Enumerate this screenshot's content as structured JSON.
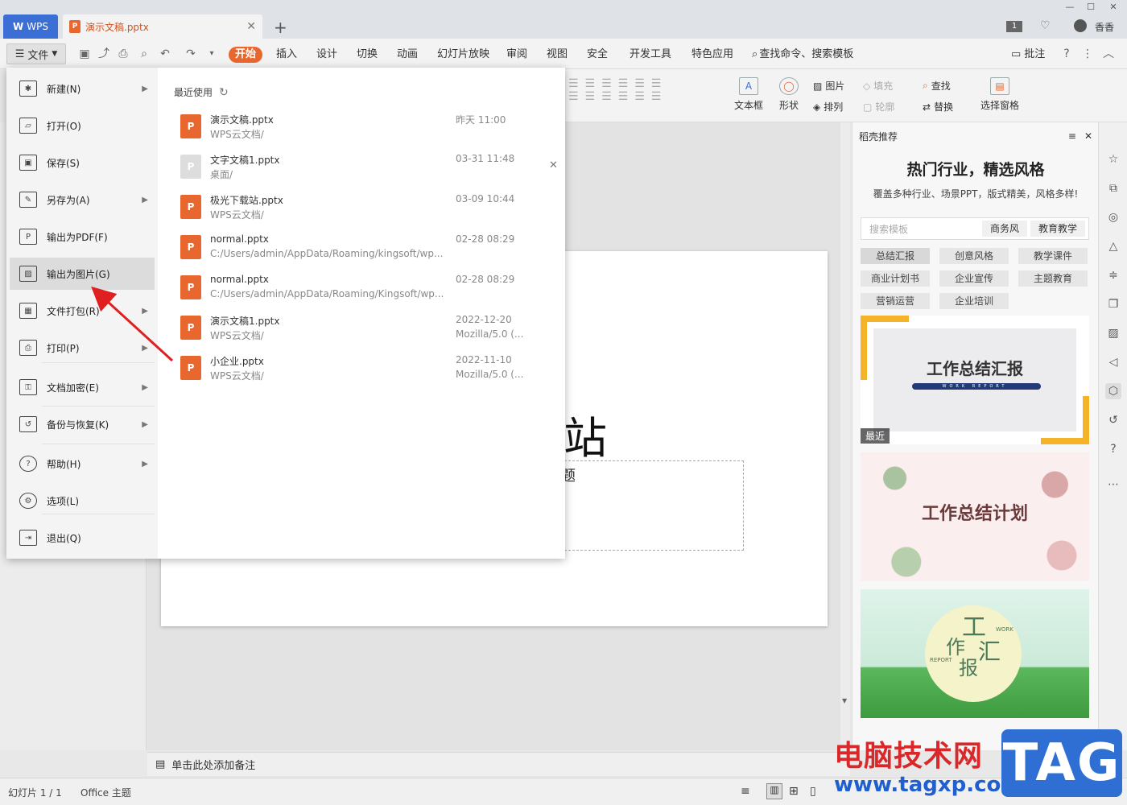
{
  "titlebar": {
    "wps_tab": "WPS",
    "doc_tab": "演示文稿.pptx",
    "page_badge": "1",
    "user": "香香"
  },
  "menubar": {
    "file": "文件",
    "tabs": [
      "开始",
      "插入",
      "设计",
      "切换",
      "动画",
      "幻灯片放映",
      "审阅",
      "视图",
      "安全",
      "开发工具",
      "特色应用"
    ],
    "search": "查找命令、搜索模板",
    "comment": "批注"
  },
  "ribbon": {
    "textbox": "文本框",
    "shape": "形状",
    "picture": "图片",
    "fill": "填充",
    "find": "查找",
    "arrange": "排列",
    "outline": "轮廓",
    "replace": "替换",
    "pane": "选择窗格"
  },
  "file_menu": {
    "items": [
      {
        "label": "新建(N)",
        "icon": "new-icon"
      },
      {
        "label": "打开(O)",
        "icon": "open-icon"
      },
      {
        "label": "保存(S)",
        "icon": "save-icon"
      },
      {
        "label": "另存为(A)",
        "icon": "save-as-icon"
      },
      {
        "label": "输出为PDF(F)",
        "icon": "pdf-icon"
      },
      {
        "label": "输出为图片(G)",
        "icon": "image-icon"
      },
      {
        "label": "文件打包(R)",
        "icon": "package-icon"
      },
      {
        "label": "打印(P)",
        "icon": "print-icon"
      },
      {
        "label": "文档加密(E)",
        "icon": "encrypt-icon"
      },
      {
        "label": "备份与恢复(K)",
        "icon": "backup-icon"
      },
      {
        "label": "帮助(H)",
        "icon": "help-icon"
      },
      {
        "label": "选项(L)",
        "icon": "options-icon"
      },
      {
        "label": "退出(Q)",
        "icon": "exit-icon"
      }
    ],
    "recent_title": "最近使用",
    "recent_files": [
      {
        "name": "演示文稿.pptx",
        "path": "WPS云文档/",
        "date": "昨天 11:00",
        "extra": ""
      },
      {
        "name": "文字文稿1.pptx",
        "path": "桌面/",
        "date": "03-31 11:48",
        "extra": ""
      },
      {
        "name": "极光下载站.pptx",
        "path": "WPS云文档/",
        "date": "03-09 10:44",
        "extra": ""
      },
      {
        "name": "normal.pptx",
        "path": "C:/Users/admin/AppData/Roaming/kingsoft/wp...",
        "date": "02-28 08:29",
        "extra": ""
      },
      {
        "name": "normal.pptx",
        "path": "C:/Users/admin/AppData/Roaming/Kingsoft/wp...",
        "date": "02-28 08:29",
        "extra": ""
      },
      {
        "name": "演示文稿1.pptx",
        "path": "WPS云文档/",
        "date": "2022-12-20",
        "extra": "Mozilla/5.0 (..."
      },
      {
        "name": "小企业.pptx",
        "path": "WPS云文档/",
        "date": "2022-11-10",
        "extra": "Mozilla/5.0 (..."
      }
    ]
  },
  "slide": {
    "title_fragment": "站",
    "sub_fragment": "题"
  },
  "notes": "单击此处添加备注",
  "status": {
    "slide_count": "幻灯片 1 / 1",
    "theme": "Office 主题"
  },
  "right_panel": {
    "header": "稻壳推荐",
    "title": "热门行业，精选风格",
    "subtitle": "覆盖多种行业、场景PPT，版式精美，风格多样!",
    "search_placeholder": "搜索模板",
    "chips": [
      "商务风",
      "教育教学"
    ],
    "tags": [
      "总结汇报",
      "创意风格",
      "教学课件",
      "商业计划书",
      "企业宣传",
      "主题教育",
      "营销运营",
      "企业培训"
    ],
    "thumb1_title": "工作总结汇报",
    "thumb1_sub": "WORK REPORT",
    "thumb1_badge": "最近",
    "thumb2_title": "工作总结计划",
    "thumb3_title_a": "工",
    "thumb3_title_b": "作",
    "thumb3_title_c": "汇",
    "thumb3_title_d": "报",
    "thumb3_work": "WORK",
    "thumb3_report": "REPORT"
  },
  "watermark": {
    "site_cn": "电脑技术网",
    "site_url": "www.tagxp.com",
    "tag": "TAG"
  },
  "colors": {
    "accent": "#e8672f",
    "wps_blue": "#3b6fd6",
    "arrow": "#e02020"
  }
}
